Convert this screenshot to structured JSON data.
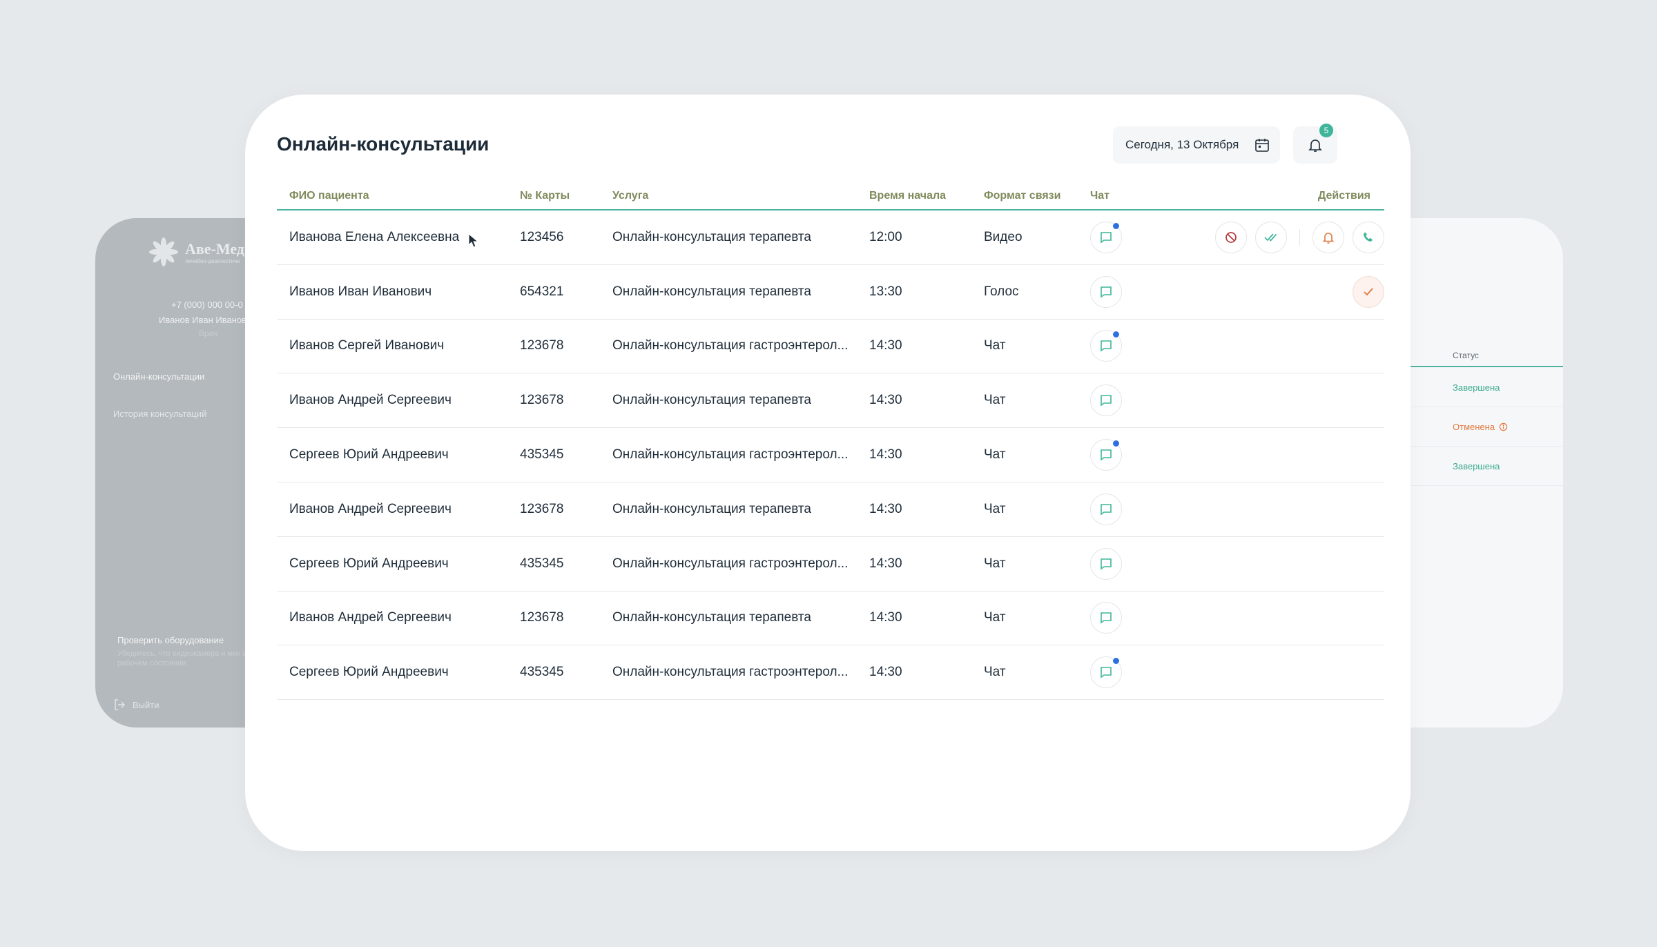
{
  "colors": {
    "accent": "#3fb59a",
    "header_line": "#4fb3a4",
    "header_text": "#7f8a5c",
    "unread_dot": "#2e6fe0",
    "warning": "#e0793f",
    "danger": "#b23a3a"
  },
  "sidebar": {
    "logo_title": "Аве-Мед",
    "logo_subtitle": "лечебно-диагностиче",
    "phone": "+7 (000) 000 00-0",
    "user_name": "Иванов Иван Иванов",
    "user_role": "Врач",
    "nav": [
      {
        "label": "Онлайн-консультации",
        "active": true
      },
      {
        "label": "История консультаций",
        "active": false
      }
    ],
    "equipment_title": "Проверить оборудование",
    "equipment_hint": "Убедитесь, что видеокамера и мик в рабочем состоянии",
    "logout_label": "Выйти"
  },
  "right_panel": {
    "header": "Статус",
    "statuses": [
      {
        "label": "Завершена",
        "type": "done"
      },
      {
        "label": "Отменена",
        "type": "cancel"
      },
      {
        "label": "Завершена",
        "type": "done"
      }
    ]
  },
  "header": {
    "title": "Онлайн-консультации",
    "date_label": "Сегодня, 13 Октября",
    "notifications_count": "5"
  },
  "table": {
    "columns": {
      "name": "ФИО пациента",
      "card": "№ Карты",
      "service": "Услуга",
      "time": "Время начала",
      "format": "Формат связи",
      "chat": "Чат",
      "actions": "Действия"
    },
    "rows": [
      {
        "name": "Иванова Елена Алексеевна",
        "card": "123456",
        "service": "Онлайн-консультация терапевта",
        "time": "12:00",
        "format": "Видео",
        "unread": true,
        "actions": "full"
      },
      {
        "name": "Иванов Иван Иванович",
        "card": "654321",
        "service": "Онлайн-консультация терапевта",
        "time": "13:30",
        "format": "Голос",
        "unread": false,
        "actions": "done"
      },
      {
        "name": "Иванов Сергей Иванович",
        "card": "123678",
        "service": "Онлайн-консультация гастроэнтерол...",
        "time": "14:30",
        "format": "Чат",
        "unread": true,
        "actions": "none"
      },
      {
        "name": "Иванов Андрей Сергеевич",
        "card": "123678",
        "service": "Онлайн-консультация терапевта",
        "time": "14:30",
        "format": "Чат",
        "unread": false,
        "actions": "none"
      },
      {
        "name": "Сергеев Юрий Андреевич",
        "card": "435345",
        "service": "Онлайн-консультация гастроэнтерол...",
        "time": "14:30",
        "format": "Чат",
        "unread": true,
        "actions": "none"
      },
      {
        "name": "Иванов Андрей Сергеевич",
        "card": "123678",
        "service": "Онлайн-консультация терапевта",
        "time": "14:30",
        "format": "Чат",
        "unread": false,
        "actions": "none"
      },
      {
        "name": "Сергеев Юрий Андреевич",
        "card": "435345",
        "service": "Онлайн-консультация гастроэнтерол...",
        "time": "14:30",
        "format": "Чат",
        "unread": false,
        "actions": "none"
      },
      {
        "name": "Иванов Андрей Сергеевич",
        "card": "123678",
        "service": "Онлайн-консультация терапевта",
        "time": "14:30",
        "format": "Чат",
        "unread": false,
        "actions": "none"
      },
      {
        "name": "Сергеев Юрий Андреевич",
        "card": "435345",
        "service": "Онлайн-консультация гастроэнтерол...",
        "time": "14:30",
        "format": "Чат",
        "unread": true,
        "actions": "none"
      }
    ]
  }
}
